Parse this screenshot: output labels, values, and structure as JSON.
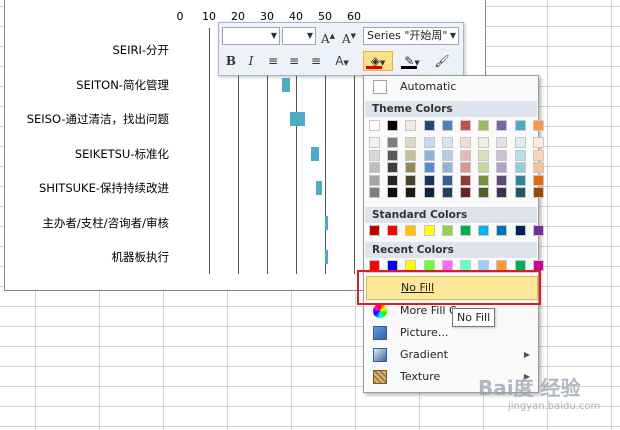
{
  "chart": {
    "axis_ticks": [
      "0",
      "10",
      "20",
      "30",
      "40",
      "50",
      "60"
    ],
    "series_color": "#4bacc6"
  },
  "chart_data": {
    "type": "bar",
    "orientation": "horizontal",
    "categories": [
      "SEIRI-分开",
      "SEITON-简化管理",
      "SEISO-通过清洁，找出问题",
      "SEIKETSU-标准化",
      "SHITSUKE-保持持续改进",
      "主办者/支柱/咨询者/审核",
      "机器板执行"
    ],
    "series": [
      {
        "start": [
          0,
          35,
          38,
          45,
          47,
          50,
          50
        ],
        "values": [
          0,
          3,
          5,
          3,
          2,
          1,
          0.5
        ]
      }
    ],
    "xlim": [
      0,
      60
    ],
    "grid": true
  },
  "toolbar": {
    "font_name": "",
    "font_size": "",
    "series_selector": "Series \"开始周\"",
    "bold": "B",
    "italic": "I",
    "grow_font": "A",
    "shrink_font": "A"
  },
  "fill_menu": {
    "automatic": "Automatic",
    "theme_colors": "Theme Colors",
    "standard_colors": "Standard Colors",
    "recent_colors": "Recent Colors",
    "no_fill": "No Fill",
    "more_fill": "More Fill C",
    "picture": "Picture...",
    "gradient": "Gradient",
    "texture": "Texture",
    "theme_top": [
      "#ffffff",
      "#000000",
      "#eeece1",
      "#1f497d",
      "#4f81bd",
      "#c0504d",
      "#9bbb59",
      "#8064a2",
      "#4bacc6",
      "#f79646"
    ],
    "theme_shades": [
      [
        "#f2f2f2",
        "#7f7f7f",
        "#ddd9c3",
        "#c6d9f0",
        "#dbe5f1",
        "#f2dcdb",
        "#ebf1dd",
        "#e5e0ec",
        "#dbeef3",
        "#fdeada"
      ],
      [
        "#d8d8d8",
        "#595959",
        "#c4bd97",
        "#8db3e2",
        "#b8cce4",
        "#e5b9b7",
        "#d7e3bc",
        "#ccc1d9",
        "#b7dde8",
        "#fbd5b5"
      ],
      [
        "#bfbfbf",
        "#3f3f3f",
        "#938953",
        "#548dd4",
        "#95b3d7",
        "#d99694",
        "#c3d69b",
        "#b2a2c7",
        "#92cddc",
        "#fac08f"
      ],
      [
        "#a5a5a5",
        "#262626",
        "#494429",
        "#17365d",
        "#366092",
        "#953734",
        "#76923c",
        "#5f497a",
        "#31859b",
        "#e36c09"
      ],
      [
        "#7f7f7f",
        "#0c0c0c",
        "#1d1b10",
        "#0f243e",
        "#244061",
        "#632423",
        "#4f6128",
        "#3f3151",
        "#205867",
        "#974806"
      ]
    ],
    "standard": [
      "#c00000",
      "#ff0000",
      "#ffc000",
      "#ffff00",
      "#92d050",
      "#00b050",
      "#00b0f0",
      "#0070c0",
      "#002060",
      "#7030a0"
    ],
    "recent": [
      "#ff0000",
      "#0000ff",
      "#ffff00",
      "#66ff33",
      "#ff66ff",
      "#66ffcc",
      "#99ccff",
      "#ff9933",
      "#00b050",
      "#cc0099"
    ]
  },
  "tooltip": "No Fill",
  "watermark": {
    "main": "Bai度 经验",
    "sub": "jingyan.baidu.com"
  }
}
